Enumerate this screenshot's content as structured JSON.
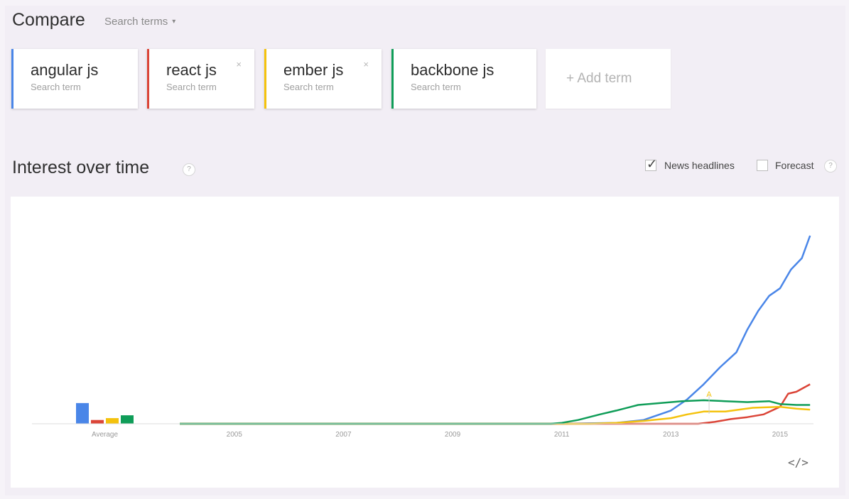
{
  "header": {
    "title": "Compare",
    "search_terms_label": "Search terms",
    "caret": "▾"
  },
  "terms": [
    {
      "name": "angular js",
      "sub": "Search term",
      "color": "#4a86e8",
      "closable": false
    },
    {
      "name": "react js",
      "sub": "Search term",
      "color": "#db4437",
      "closable": true
    },
    {
      "name": "ember js",
      "sub": "Search term",
      "color": "#f4c20d",
      "closable": true
    },
    {
      "name": "backbone js",
      "sub": "Search term",
      "color": "#0f9d58",
      "closable": false
    }
  ],
  "add_term_label": "+ Add term",
  "close_glyph": "×",
  "section": {
    "title": "Interest over time",
    "help_glyph": "?",
    "news_headlines_label": "News headlines",
    "news_headlines_checked": true,
    "forecast_label": "Forecast",
    "forecast_checked": false
  },
  "embed_glyph": "</>",
  "chart_data": {
    "type": "line",
    "x_tick_labels": [
      "2005",
      "2007",
      "2009",
      "2011",
      "2013",
      "2015"
    ],
    "average_label": "Average",
    "xlim": [
      2004,
      2015.6
    ],
    "ylim": [
      0,
      100
    ],
    "annotation": {
      "label": "A",
      "x": 2013.7,
      "color": "#f4c20d"
    },
    "averages": [
      {
        "name": "angular js",
        "color": "#4a86e8",
        "value": 11
      },
      {
        "name": "react js",
        "color": "#db4437",
        "value": 2
      },
      {
        "name": "ember js",
        "color": "#f4c20d",
        "value": 3
      },
      {
        "name": "backbone js",
        "color": "#0f9d58",
        "value": 4.5
      }
    ],
    "series": [
      {
        "name": "angular js",
        "color": "#4a86e8",
        "x": [
          2004,
          2011.0,
          2012.0,
          2012.5,
          2013.0,
          2013.3,
          2013.6,
          2013.9,
          2014.2,
          2014.4,
          2014.6,
          2014.8,
          2015.0,
          2015.2,
          2015.4,
          2015.55
        ],
        "y": [
          0,
          0,
          0.5,
          2,
          7,
          13,
          21,
          30,
          38,
          50,
          60,
          68,
          72,
          82,
          88,
          100
        ]
      },
      {
        "name": "react js",
        "color": "#db4437",
        "x": [
          2004,
          2012.0,
          2013.5,
          2013.8,
          2014.1,
          2014.4,
          2014.7,
          2015.0,
          2015.15,
          2015.3,
          2015.55
        ],
        "y": [
          0,
          0,
          0,
          1,
          2.5,
          3.5,
          5,
          9,
          16,
          17,
          21
        ]
      },
      {
        "name": "ember js",
        "color": "#f4c20d",
        "x": [
          2004,
          2011.5,
          2012.0,
          2012.5,
          2013.0,
          2013.3,
          2013.6,
          2014.0,
          2014.5,
          2015.0,
          2015.3,
          2015.55
        ],
        "y": [
          0,
          0,
          0.5,
          1.5,
          3,
          5,
          6.5,
          6.5,
          8.5,
          9,
          8,
          7.5
        ]
      },
      {
        "name": "backbone js",
        "color": "#0f9d58",
        "x": [
          2004,
          2010.8,
          2011.0,
          2011.3,
          2011.7,
          2012.0,
          2012.4,
          2012.8,
          2013.2,
          2013.6,
          2014.0,
          2014.4,
          2014.8,
          2015.0,
          2015.3,
          2015.55
        ],
        "y": [
          0,
          0,
          0.5,
          2,
          5,
          7,
          10,
          11,
          12,
          12.5,
          12,
          11.5,
          12,
          10.5,
          10,
          10
        ]
      }
    ]
  }
}
